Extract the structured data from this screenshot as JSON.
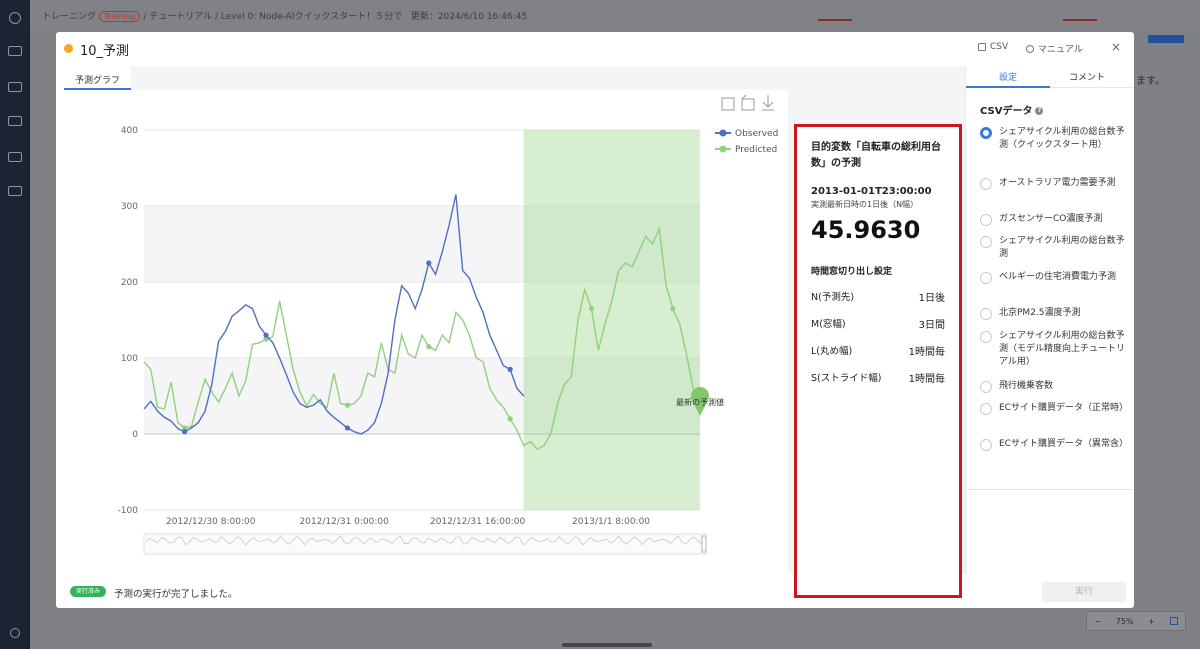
{
  "background": {
    "breadcrumb_prefix": "トレーニング",
    "breadcrumb_tag": "Training",
    "breadcrumb_rest": "/ チュートリアル / Level 0: Node-AIクイックスタート！５分で",
    "updated": "更新：2024/6/10 16:46:45",
    "right_text": "ます。",
    "zoom": {
      "minus": "−",
      "level": "75%",
      "plus": "+"
    }
  },
  "modal": {
    "title": "10_予測",
    "csv_link": "CSV",
    "manual_link": "マニュアル",
    "close": "×",
    "tab": "予測グラフ"
  },
  "chart_data": {
    "type": "line",
    "x_ticks": [
      "2012/12/30 8:00:00",
      "2012/12/31 0:00:00",
      "2012/12/31 16:00:00",
      "2013/1/1 8:00:00"
    ],
    "ylim": [
      -100,
      400
    ],
    "y_ticks": [
      -100,
      0,
      100,
      200,
      300,
      400
    ],
    "grid": true,
    "legend_placement": "top-right",
    "annotation": "最新の予測値",
    "series": [
      {
        "name": "Observed",
        "color": "#4f6fc0",
        "values": [
          33,
          43,
          30,
          22,
          17,
          7,
          3,
          8,
          15,
          30,
          65,
          122,
          135,
          155,
          162,
          170,
          165,
          142,
          130,
          120,
          100,
          78,
          55,
          40,
          35,
          38,
          45,
          30,
          22,
          15,
          8,
          3,
          0,
          5,
          15,
          40,
          80,
          150,
          195,
          185,
          165,
          190,
          225,
          210,
          240,
          275,
          315,
          215,
          205,
          180,
          160,
          130,
          110,
          90,
          85,
          60,
          50
        ]
      },
      {
        "name": "Predicted",
        "color": "#8fd17c",
        "values": [
          95,
          85,
          35,
          33,
          68,
          15,
          8,
          10,
          42,
          72,
          55,
          42,
          60,
          80,
          50,
          70,
          118,
          120,
          125,
          128,
          175,
          130,
          85,
          55,
          37,
          52,
          40,
          35,
          80,
          40,
          38,
          40,
          50,
          80,
          75,
          120,
          85,
          80,
          130,
          105,
          100,
          130,
          115,
          110,
          130,
          120,
          160,
          150,
          130,
          100,
          95,
          60,
          45,
          35,
          20,
          5,
          -15,
          -10,
          -20,
          -15,
          0,
          40,
          65,
          75,
          150,
          190,
          165,
          110,
          145,
          175,
          215,
          225,
          220,
          240,
          260,
          250,
          270,
          195,
          165,
          145,
          105,
          60,
          42
        ]
      }
    ]
  },
  "prediction": {
    "title": "目的変数「自転車の総利用台数」の予測",
    "timestamp": "2013-01-01T23:00:00",
    "subtitle": "実測最新日時の1日後（N幅）",
    "value": "45.9630",
    "window_title": "時間窓切り出し設定",
    "params": [
      {
        "label": "N(予測先)",
        "value": "1日後"
      },
      {
        "label": "M(窓幅)",
        "value": "3日間"
      },
      {
        "label": "L(丸め幅)",
        "value": "1時間毎"
      },
      {
        "label": "S(ストライド幅)",
        "value": "1時間毎"
      }
    ]
  },
  "side": {
    "tab_settings": "設定",
    "tab_comment": "コメント",
    "csv_heading": "CSVデータ",
    "help": "?",
    "options": [
      {
        "label": "シェアサイクル利用の総台数予測（クイックスタート用）",
        "selected": true
      },
      {
        "label": "オーストラリア電力需要予測",
        "selected": false
      },
      {
        "label": "ガスセンサーCO濃度予測",
        "selected": false
      },
      {
        "label": "シェアサイクル利用の総台数予測",
        "selected": false
      },
      {
        "label": "ベルギーの住宅消費電力予測",
        "selected": false
      },
      {
        "label": "北京PM2.5濃度予測",
        "selected": false
      },
      {
        "label": "シェアサイクル利用の総台数予測（モデル精度向上チュートリアル用）",
        "selected": false
      },
      {
        "label": "飛行機乗客数",
        "selected": false
      },
      {
        "label": "ECサイト購買データ（正常時）",
        "selected": false
      },
      {
        "label": "ECサイト購買データ（異常含）",
        "selected": false
      }
    ]
  },
  "footer": {
    "badge": "実行済み",
    "message": "予測の実行が完了しました。",
    "run_button": "実行"
  }
}
